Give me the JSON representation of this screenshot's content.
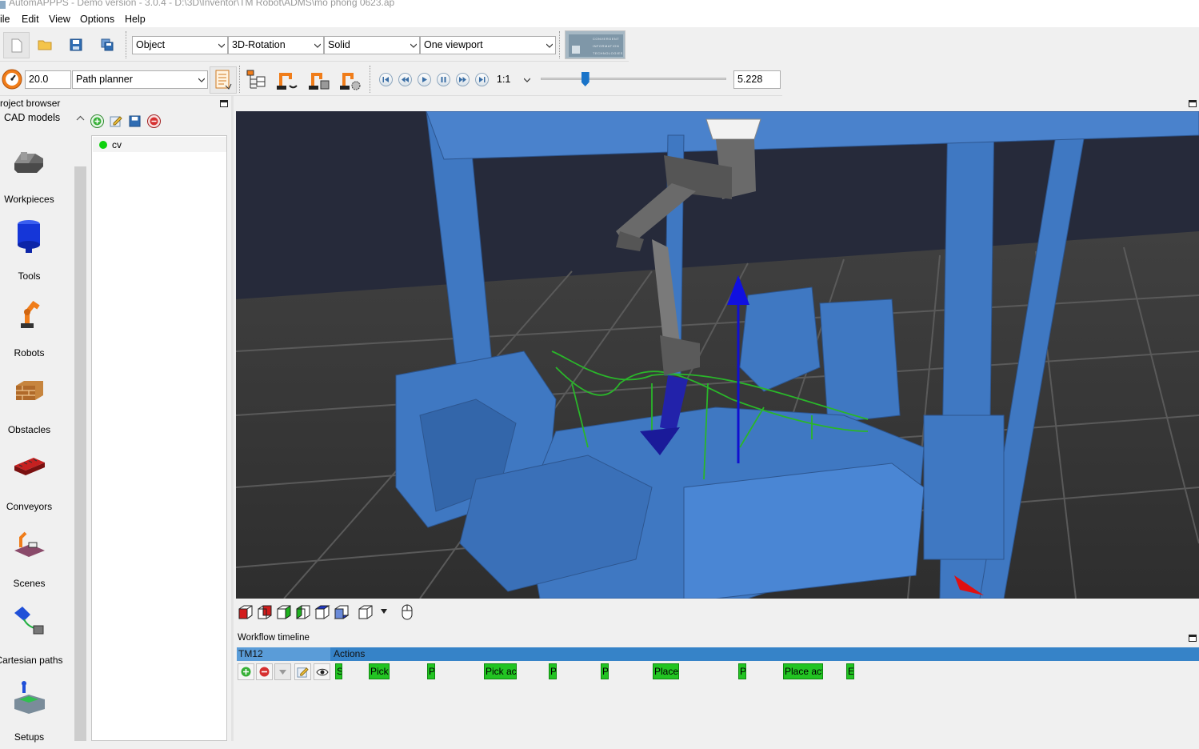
{
  "window": {
    "title": "AutomAPPPS - Demo version - 3.0.4 - D:\\3D\\Inventor\\TM Robot\\ADMS\\mo phong 0623.ap"
  },
  "menu": {
    "items": [
      "ile",
      "Edit",
      "View",
      "Options",
      "Help"
    ]
  },
  "toolbar": {
    "mode_select": "Object",
    "rotation_select": "3D-Rotation",
    "render_select": "Solid",
    "viewport_select": "One viewport",
    "logo_lines": [
      "CONVERGENT",
      "INFORMATION",
      "TECHNOLOGIES"
    ],
    "speed_value": "20.0",
    "planner_select": "Path planner",
    "playback_ratio": "1:1",
    "time_value": "5.228",
    "time_slider_fraction": 0.24
  },
  "project_browser": {
    "title": "roject browser",
    "section_header": "CAD models",
    "categories": [
      {
        "label": "Workpieces",
        "icon": "workpiece-icon"
      },
      {
        "label": "Tools",
        "icon": "tool-icon"
      },
      {
        "label": "Robots",
        "icon": "robot-icon"
      },
      {
        "label": "Obstacles",
        "icon": "obstacle-icon"
      },
      {
        "label": "Conveyors",
        "icon": "conveyor-icon"
      },
      {
        "label": "Scenes",
        "icon": "scene-icon"
      },
      {
        "label": "Cartesian paths",
        "icon": "cartesian-path-icon"
      },
      {
        "label": "Setups",
        "icon": "setup-icon"
      }
    ],
    "tree_items": [
      {
        "label": "cv",
        "status_color": "#0dd10d"
      }
    ]
  },
  "workflow": {
    "title": "Workflow timeline",
    "robot_column": "TM12",
    "actions_column": "Actions",
    "actions": [
      "S",
      "Pick",
      "P",
      "Pick act",
      "P",
      "P",
      "Place",
      "P",
      "Place act",
      "E"
    ]
  },
  "colors": {
    "scene_blue": "#3f78c2",
    "action_green": "#22c422",
    "header_blue": "#3683c8",
    "viewport_bg": "#3a3a3a"
  }
}
